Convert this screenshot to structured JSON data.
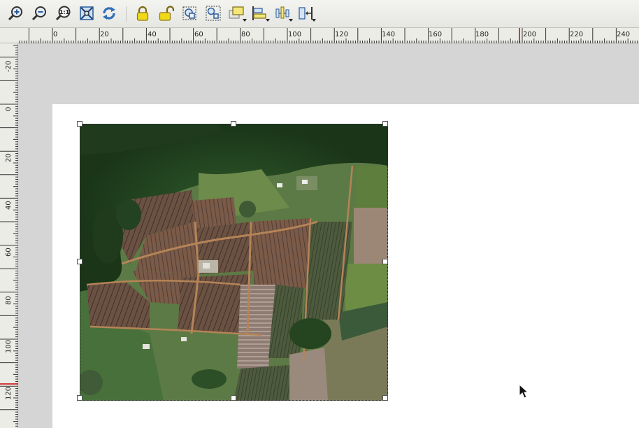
{
  "toolbar": {
    "buttons": [
      {
        "name": "zoom-in-button",
        "icon": "zoom-in-icon",
        "has_dropdown": false
      },
      {
        "name": "zoom-out-button",
        "icon": "zoom-out-icon",
        "has_dropdown": false
      },
      {
        "name": "zoom-actual-button",
        "icon": "zoom-1-1-icon",
        "label": "1:1",
        "has_dropdown": false
      },
      {
        "name": "zoom-full-button",
        "icon": "zoom-full-extent-icon",
        "has_dropdown": false
      },
      {
        "name": "refresh-button",
        "icon": "refresh-icon",
        "has_dropdown": false
      },
      {
        "name": "lock-items-button",
        "icon": "lock-icon",
        "has_dropdown": false
      },
      {
        "name": "unlock-items-button",
        "icon": "unlock-icon",
        "has_dropdown": false
      },
      {
        "name": "group-items-button",
        "icon": "group-icon",
        "has_dropdown": false
      },
      {
        "name": "ungroup-items-button",
        "icon": "ungroup-icon",
        "has_dropdown": false
      },
      {
        "name": "raise-items-button",
        "icon": "raise-icon",
        "has_dropdown": true
      },
      {
        "name": "align-left-button",
        "icon": "align-left-icon",
        "has_dropdown": true
      },
      {
        "name": "distribute-button",
        "icon": "distribute-icon",
        "has_dropdown": true
      },
      {
        "name": "resize-button",
        "icon": "resize-icon",
        "has_dropdown": true
      }
    ]
  },
  "ruler_h": {
    "labels": [
      "0",
      "20",
      "40",
      "60",
      "80",
      "100",
      "120",
      "140",
      "160",
      "180",
      "200",
      "220",
      "240"
    ]
  },
  "ruler_v": {
    "labels": [
      "-20",
      "0",
      "20",
      "40",
      "60",
      "80",
      "100",
      "120"
    ]
  },
  "colors": {
    "accent_marker": "#cc0000",
    "selection_handle": "#ffffff",
    "paper": "#ffffff",
    "canvas": "#d5d5d5"
  },
  "map_item": {
    "type": "aerial-imagery"
  }
}
